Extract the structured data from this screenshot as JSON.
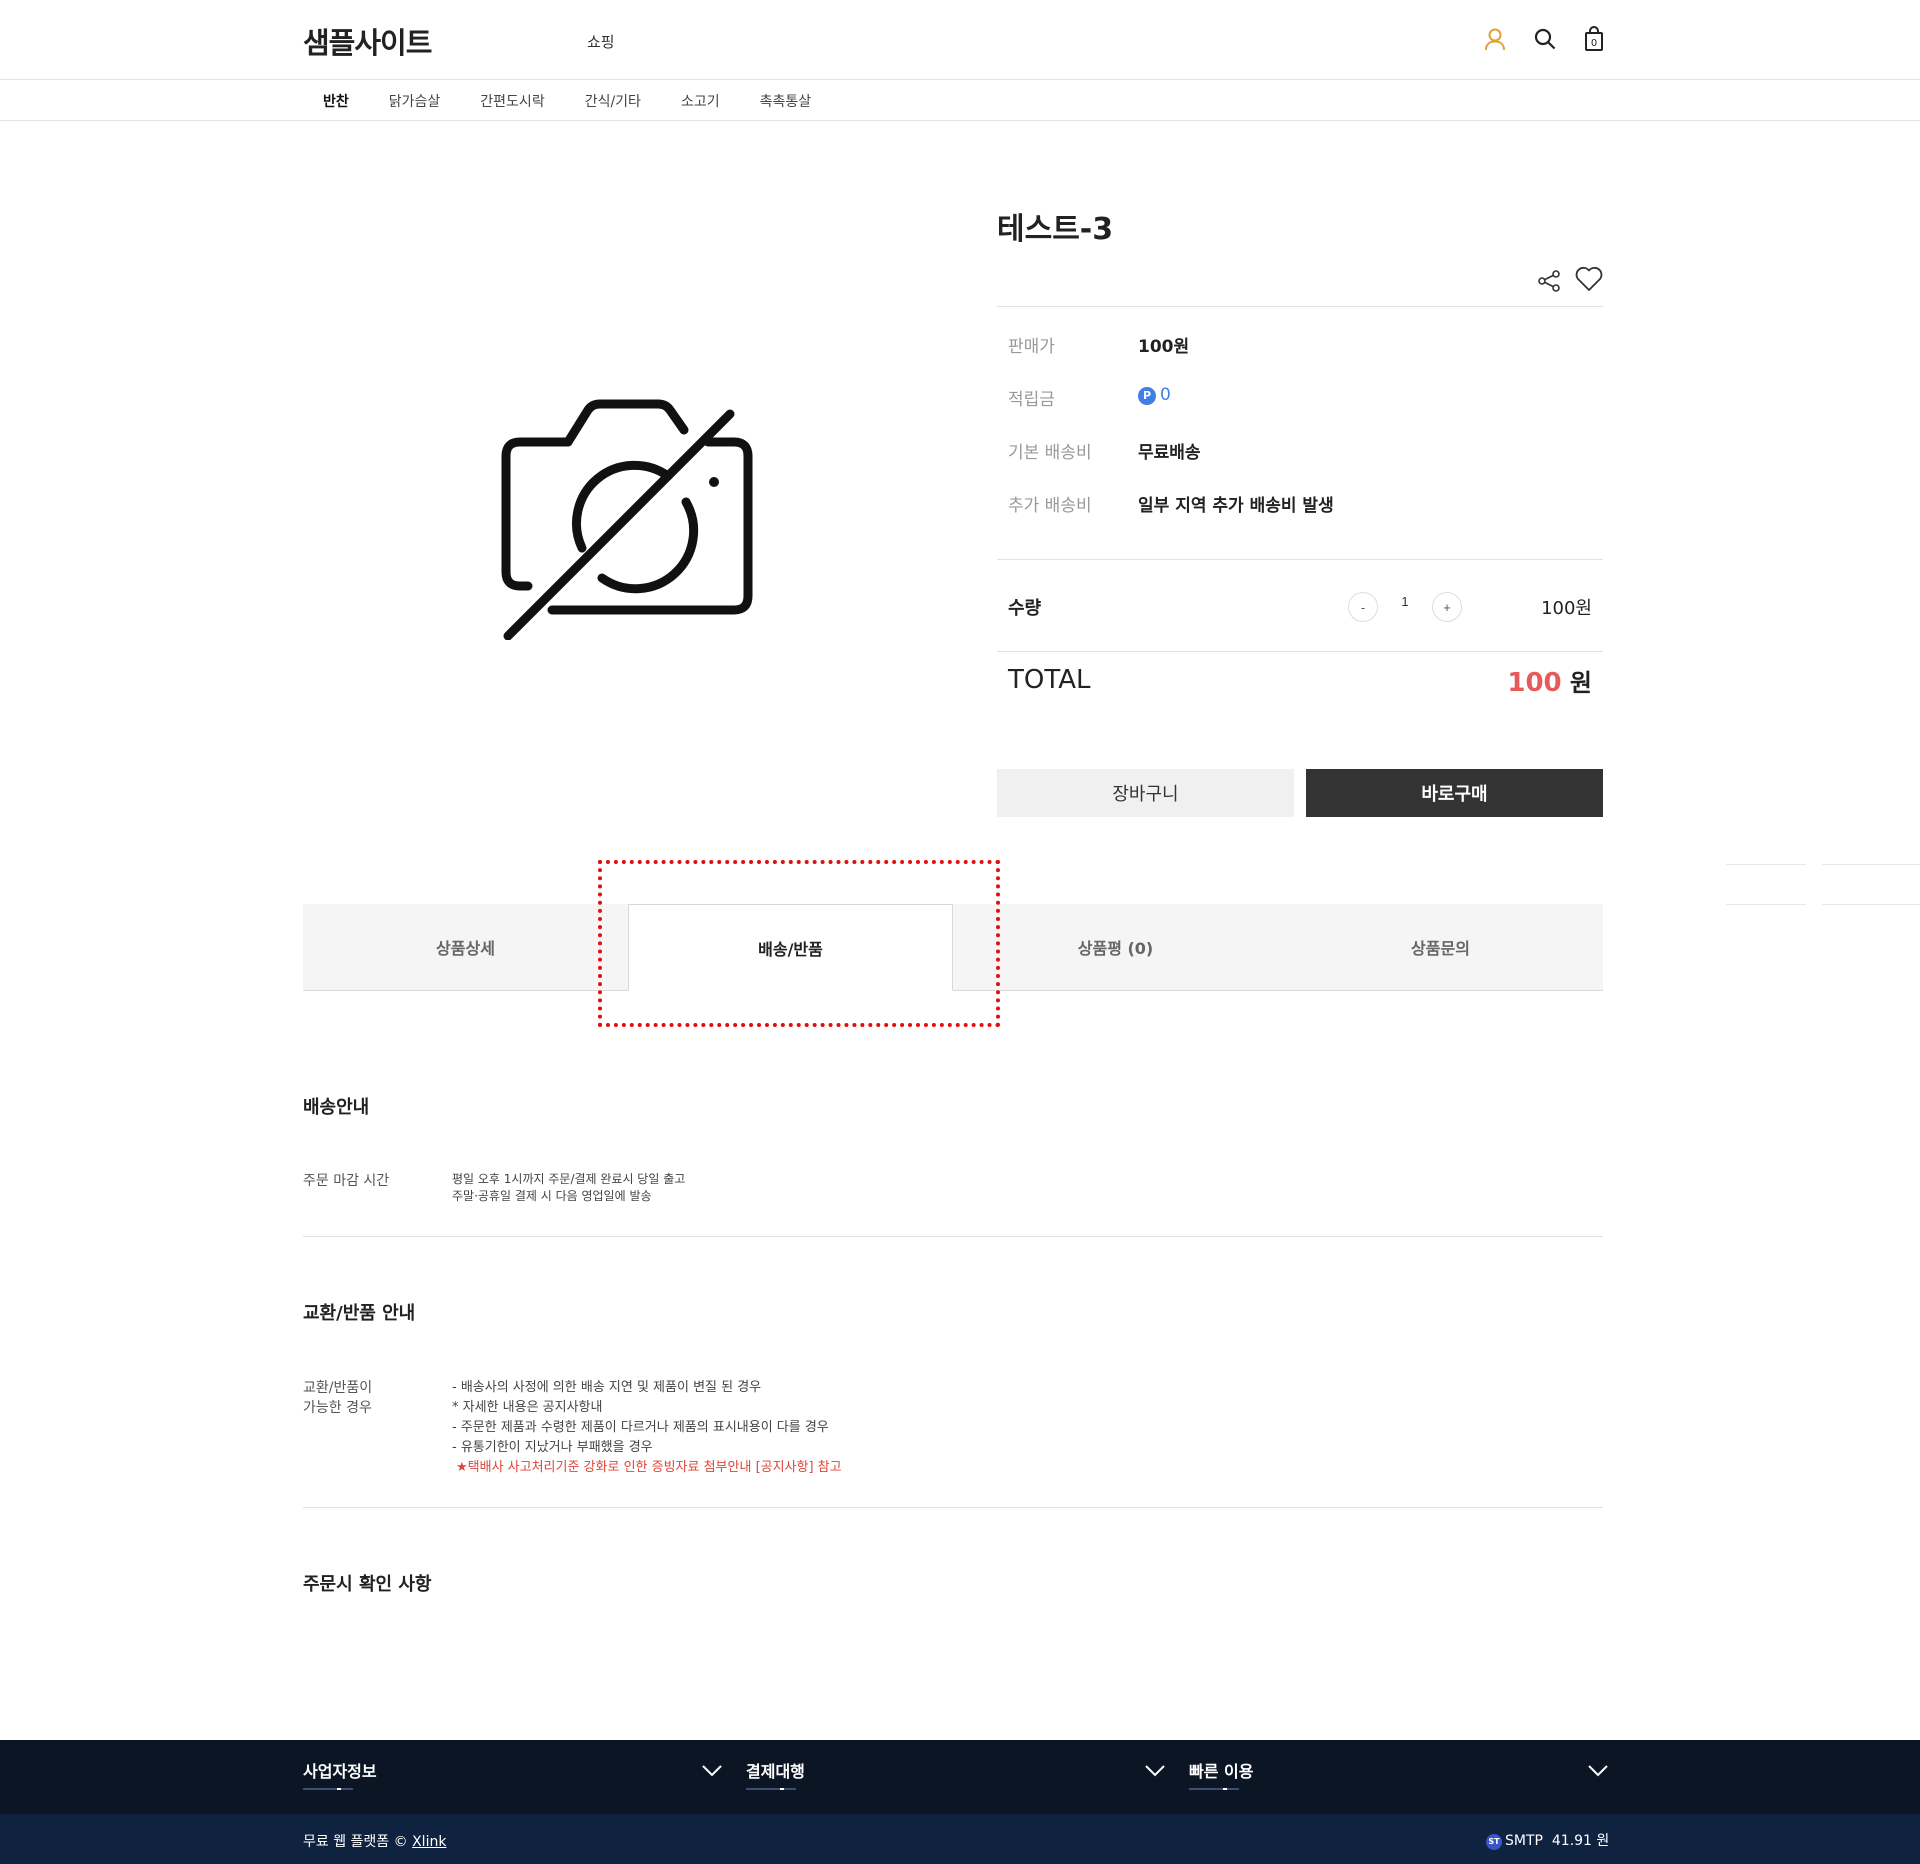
{
  "header": {
    "logo": "샘플사이트",
    "top_link": "쇼핑",
    "user_icon": "user-icon",
    "search_icon": "search-icon",
    "cart_icon": "shopping-bag-icon",
    "cart_count": "0",
    "accent_color": "#e0a13b"
  },
  "categories": [
    "반찬",
    "닭가슴살",
    "간편도시락",
    "간식/기타",
    "소고기",
    "촉촉통살"
  ],
  "product": {
    "image_icon": "no-image-camera-icon",
    "title": "테스트-3",
    "share_icon": "share-icon",
    "wish_icon": "heart-icon",
    "info": {
      "price_label": "판매가",
      "price_value": "100원",
      "points_label": "적립금",
      "points_badge": "P",
      "points_value": "0",
      "shipping_label": "기본 배송비",
      "shipping_value": "무료배송",
      "extra_label": "추가 배송비",
      "extra_value": "일부 지역 추가 배송비 발생"
    },
    "quantity": {
      "label": "수량",
      "minus": "-",
      "value": "1",
      "plus": "+",
      "price": "100원"
    },
    "total": {
      "label": "TOTAL",
      "amount": "100",
      "unit": "원",
      "amount_color": "#e75a5a"
    },
    "buttons": {
      "cart": "장바구니",
      "buy": "바로구매"
    }
  },
  "tabs": {
    "items": [
      "상품상세",
      "배송/반품",
      "상품평 (0)",
      "상품문의"
    ],
    "active_index": 1
  },
  "delivery": {
    "title": "배송안내",
    "label": "주문 마감 시간",
    "lines": [
      "평일 오후 1시까지 주문/결제 완료시 당일 출고",
      "주말·공휴일 결제 시 다음 영업일에 발송"
    ]
  },
  "exchange": {
    "title": "교환/반품 안내",
    "label_line1": "교환/반품이",
    "label_line2": "가능한 경우",
    "lines": [
      "- 배송사의 사정에 의한 배송 지연 및 제품이 변질 된 경우",
      "* 자세한 내용은 공지사항내",
      "- 주문한 제품과 수령한 제품이 다르거나 제품의 표시내용이 다를 경우",
      "- 유통기한이 지났거나 부패했을 경우"
    ],
    "notice": "★택배사 사고처리기준 강화로 인한 증빙자료 첨부안내 [공지사항] 참고",
    "notice_color": "#e0453a"
  },
  "order_check": {
    "title": "주문시 확인 사항"
  },
  "footer": {
    "columns": [
      "사업자정보",
      "결제대행",
      "빠른 이용"
    ],
    "chevron_icon": "chevron-down-icon",
    "copy_prefix": "무료 웹 플랫폼 © ",
    "copy_link": "Xlink",
    "smtp_badge": "ST",
    "smtp_label": "SMTP",
    "smtp_value": "41.91 원",
    "bg_top": "#0b1524",
    "bg_bottom": "#0f2341"
  }
}
